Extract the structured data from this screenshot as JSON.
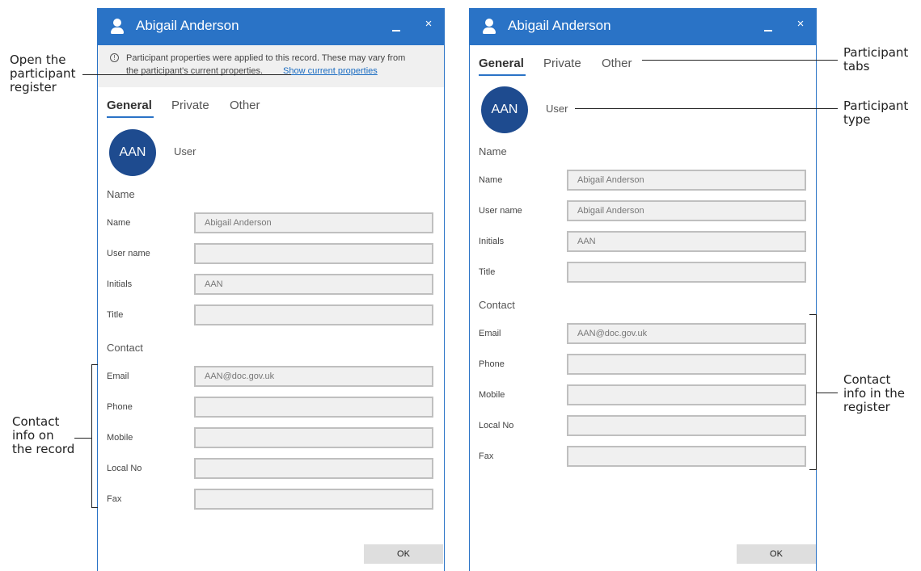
{
  "left_window": {
    "title": "Abigail Anderson",
    "close_glyph": "×",
    "banner": {
      "info_glyph": "!",
      "line1": "Participant properties were applied to this record. These may vary from",
      "line2": "the participant's current properties.",
      "link": "Show current properties"
    },
    "tabs": [
      "General",
      "Private",
      "Other"
    ],
    "avatar": "AAN",
    "type": "User",
    "name_section": "Name",
    "contact_section": "Contact",
    "fields": {
      "name": {
        "label": "Name",
        "value": "Abigail Anderson"
      },
      "username": {
        "label": "User name",
        "value": ""
      },
      "initials": {
        "label": "Initials",
        "value": "AAN"
      },
      "title": {
        "label": "Title",
        "value": ""
      },
      "email": {
        "label": "Email",
        "value": "AAN@doc.gov.uk"
      },
      "phone": {
        "label": "Phone",
        "value": ""
      },
      "mobile": {
        "label": "Mobile",
        "value": ""
      },
      "localno": {
        "label": "Local No",
        "value": ""
      },
      "fax": {
        "label": "Fax",
        "value": ""
      }
    },
    "ok": "OK"
  },
  "right_window": {
    "title": "Abigail Anderson",
    "close_glyph": "×",
    "tabs": [
      "General",
      "Private",
      "Other"
    ],
    "avatar": "AAN",
    "type": "User",
    "name_section": "Name",
    "contact_section": "Contact",
    "fields": {
      "name": {
        "label": "Name",
        "value": "Abigail Anderson"
      },
      "username": {
        "label": "User name",
        "value": "Abigail Anderson"
      },
      "initials": {
        "label": "Initials",
        "value": "AAN"
      },
      "title": {
        "label": "Title",
        "value": ""
      },
      "email": {
        "label": "Email",
        "value": "AAN@doc.gov.uk"
      },
      "phone": {
        "label": "Phone",
        "value": ""
      },
      "mobile": {
        "label": "Mobile",
        "value": ""
      },
      "localno": {
        "label": "Local No",
        "value": ""
      },
      "fax": {
        "label": "Fax",
        "value": ""
      }
    },
    "ok": "OK"
  },
  "annotations": {
    "open_register": [
      "Open the",
      "participant",
      "register"
    ],
    "contact_record": [
      "Contact",
      "info on",
      "the record"
    ],
    "participant_tabs": [
      "Participant",
      "tabs"
    ],
    "participant_type": [
      "Participant",
      "type"
    ],
    "contact_register": [
      "Contact",
      "info in the",
      "register"
    ]
  },
  "colors": {
    "title_bar": "#2a73c6",
    "avatar": "#1e4b8f",
    "link": "#1a6cc2",
    "tab_underline": "#2a73c6"
  }
}
